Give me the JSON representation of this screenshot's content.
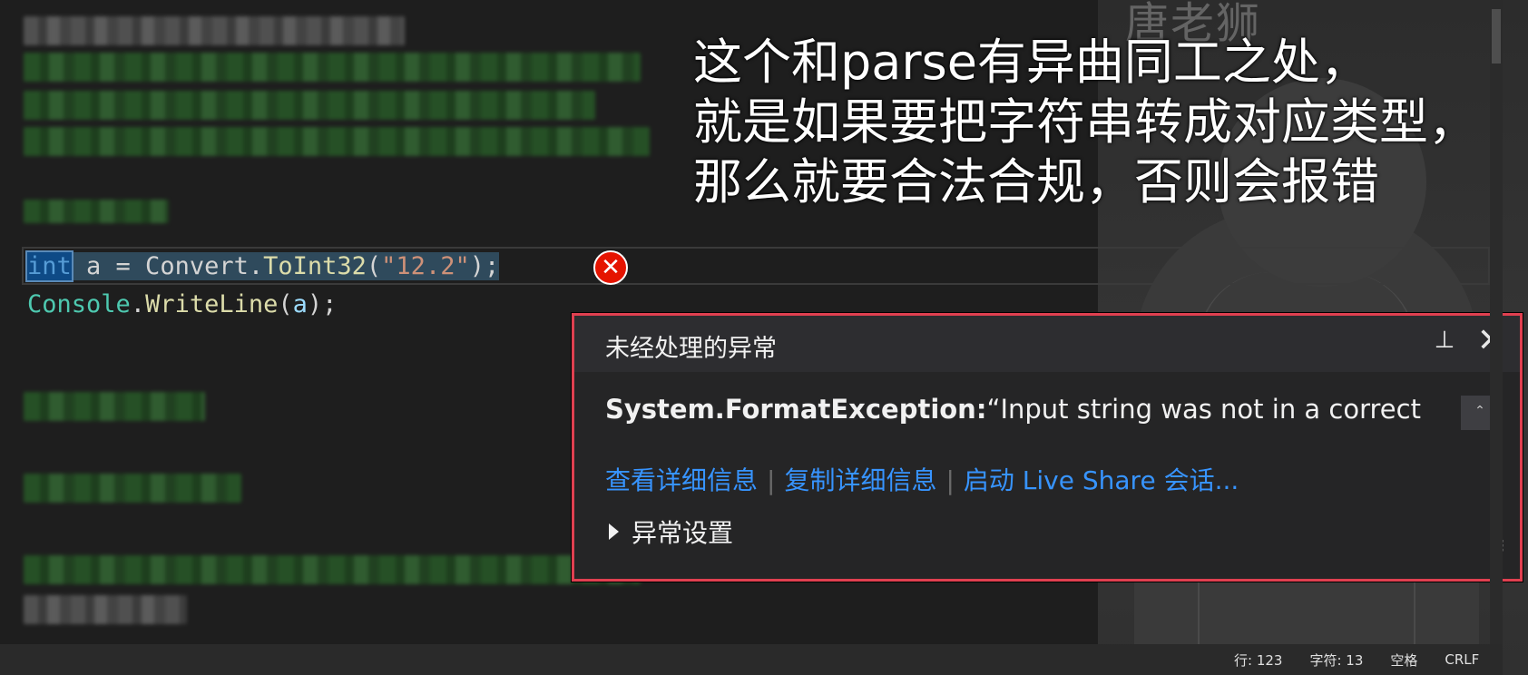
{
  "watermark": "唐老狮",
  "subtitle": {
    "line1": "这个和parse有异曲同工之处，",
    "line2": "就是如果要把字符串转成对应类型，",
    "line3": "那么就要合法合规，否则会报错"
  },
  "code": {
    "line1": {
      "keyword": "int",
      "rest_start": " a = Convert.",
      "method": "ToInt32",
      "open_paren": "(",
      "string_literal": "\"12.2\"",
      "close": ");"
    },
    "line2": {
      "class": "Console",
      "dot": ".",
      "method": "WriteLine",
      "open": "(",
      "arg": "a",
      "close": ");"
    }
  },
  "exception_popup": {
    "title": "未经处理的异常",
    "pin_icon": "📌",
    "close_icon": "✕",
    "message_type": "System.FormatException:",
    "message_text": "“Input string was not in a correct",
    "links": [
      "查看详细信息",
      "复制详细信息",
      "启动 Live Share 会话..."
    ],
    "settings_label": "异常设置"
  },
  "status_bar": {
    "line": "行: 123",
    "char": "字符: 13",
    "whitespace": "空格",
    "line_ending": "CRLF"
  },
  "colors": {
    "error_red": "#e51400",
    "popup_border": "#e04050",
    "link_blue": "#3794ff",
    "keyword_blue": "#569cd6"
  }
}
